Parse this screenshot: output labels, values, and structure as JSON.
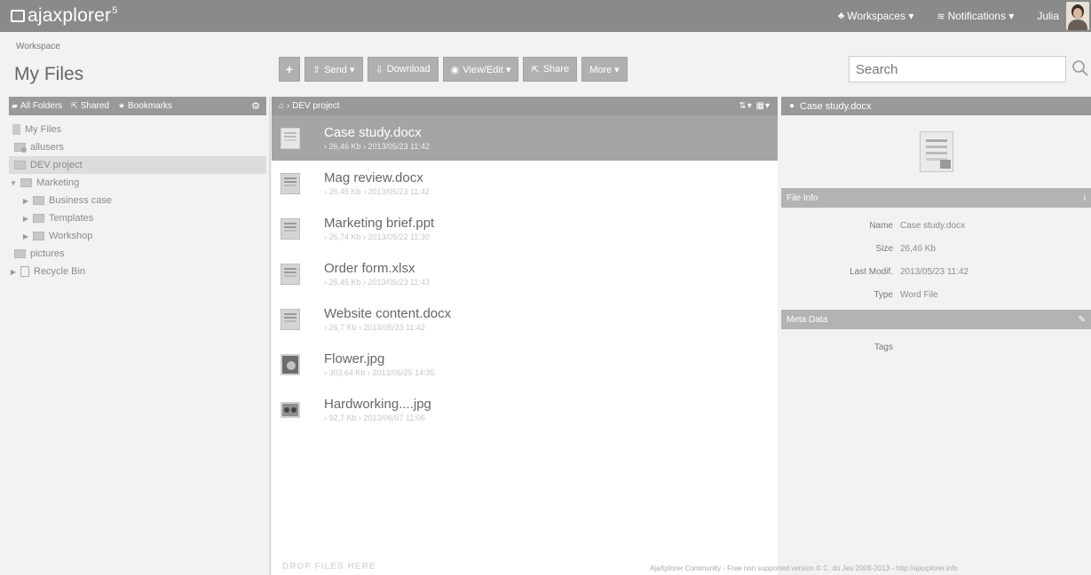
{
  "app": {
    "brand": "ajaxplorer",
    "brand_version": "5"
  },
  "topnav": {
    "workspaces": "Workspaces ▾",
    "notifications": "Notifications ▾",
    "user": "Julia"
  },
  "workspace": {
    "label": "Workspace",
    "title": "My Files"
  },
  "toolbar": {
    "plus": "+",
    "send": "Send ▾",
    "download": "Download",
    "view_edit": "View/Edit ▾",
    "share": "Share",
    "more": "More ▾"
  },
  "search": {
    "placeholder": "Search"
  },
  "left": {
    "tabs": {
      "all_folders": "All Folders",
      "shared": "Shared",
      "bookmarks": "Bookmarks"
    },
    "tree": [
      {
        "label": "My Files"
      },
      {
        "label": "allusers"
      },
      {
        "label": "DEV project"
      },
      {
        "label": "Marketing"
      },
      {
        "label": "Business case"
      },
      {
        "label": "Templates"
      },
      {
        "label": "Workshop"
      },
      {
        "label": "pictures"
      },
      {
        "label": "Recycle Bin"
      }
    ]
  },
  "center": {
    "breadcrumb": "DEV project",
    "files": [
      {
        "name": "Case study.docx",
        "meta": "› 26,46 Kb › 2013/05/23 11:42"
      },
      {
        "name": "Mag review.docx",
        "meta": "› 26,45 Kb › 2013/05/23 11:42"
      },
      {
        "name": "Marketing brief.ppt",
        "meta": "› 26,74 Kb › 2013/05/22 11:30"
      },
      {
        "name": "Order form.xlsx",
        "meta": "› 26,45 Kb › 2013/05/23 11:43"
      },
      {
        "name": "Website content.docx",
        "meta": "› 26,7 Kb › 2013/05/23 11:42"
      },
      {
        "name": "Flower.jpg",
        "meta": "› 303,64 Kb › 2013/06/25 14:35"
      },
      {
        "name": "Hardworking....jpg",
        "meta": "› 92,7 Kb › 2013/06/07 11:06"
      }
    ],
    "drop_zone": "DROP FILES HERE"
  },
  "right": {
    "title": "Case study.docx",
    "file_info_label": "File Info",
    "meta_data_label": "Meta Data",
    "info": [
      {
        "key": "Name",
        "value": "Case study.docx"
      },
      {
        "key": "Size",
        "value": "26,46 Kb"
      },
      {
        "key": "Last Modif.",
        "value": "2013/05/23 11:42"
      },
      {
        "key": "Type",
        "value": "Word File"
      }
    ],
    "tags_label": "Tags"
  },
  "footer": {
    "text": "AjaXplorer Community - Free non supported version © C. du Jeu 2008-2013 - http://ajaxplorer.info"
  }
}
